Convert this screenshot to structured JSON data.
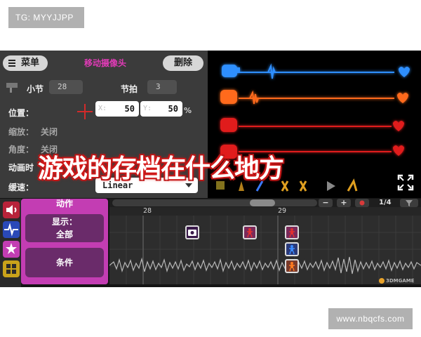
{
  "tags": {
    "top": "TG: MYYJJPP",
    "bottom": "www.nbqcfs.com"
  },
  "editor": {
    "menu_label": "菜单",
    "event_title": "移动摄像头",
    "delete_label": "删除",
    "bar_label": "小节",
    "bar_value": "28",
    "beat_label": "节拍",
    "beat_value": "3",
    "position_label": "位置：",
    "x_key": "X:",
    "x_value": "50",
    "y_key": "Y:",
    "y_value": "50",
    "percent": "%",
    "zoom_label": "缩放：",
    "zoom_value": "关闭",
    "angle_label": "角度：",
    "angle_value": "关闭",
    "anim_label": "动画时",
    "speed_label": "缓速：",
    "ease_value": "Linear"
  },
  "timeline": {
    "panel_title": "动作",
    "display_label": "显示：",
    "display_value": "全部",
    "condition_label": "条件",
    "minus": "−",
    "plus": "+",
    "page": "1/4",
    "beats": [
      "28",
      "29"
    ]
  },
  "preview": {
    "rows": [
      {
        "color": "#2f8fff",
        "glyph": "blue-monster"
      },
      {
        "color": "#ff6a1a",
        "glyph": "orange-monster"
      },
      {
        "color": "#e01c1c",
        "glyph": "red-monster"
      },
      {
        "color": "#e01c1c",
        "glyph": "red-monster"
      }
    ]
  },
  "overlay": {
    "title": "游戏的存档在什么地方"
  },
  "watermark": {
    "text": "3DMGAME"
  },
  "colors": {
    "accent_pink": "#c33db3",
    "dark_purple": "#6a2b6a",
    "panel_bg": "#3b3b3b"
  }
}
